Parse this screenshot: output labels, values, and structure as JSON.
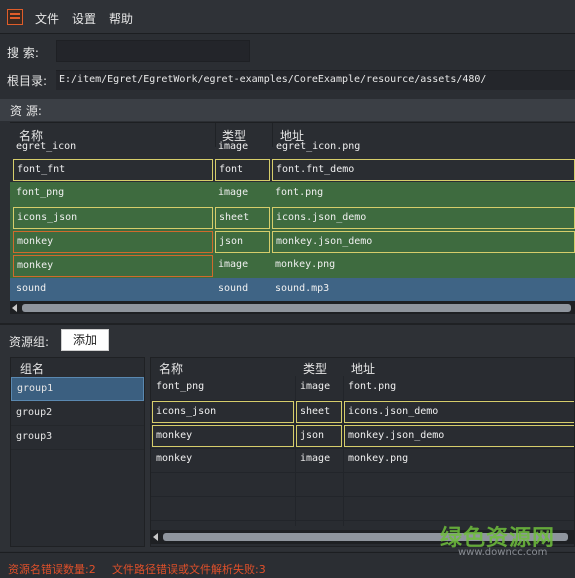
{
  "menu": {
    "file": "文件",
    "settings": "设置",
    "help": "帮助"
  },
  "search": {
    "label": "搜 索:",
    "value": ""
  },
  "root": {
    "label": "根目录:",
    "path": "E:/item/Egret/EgretWork/egret-examples/CoreExample/resource/assets/480/"
  },
  "resources": {
    "title": "资 源:",
    "headers": {
      "name": "名称",
      "type": "类型",
      "url": "地址"
    },
    "rows": [
      {
        "name": "egret_icon",
        "type": "image",
        "url": "egret_icon.png"
      },
      {
        "name": "font_fnt",
        "type": "font",
        "url": "font.fnt_demo"
      },
      {
        "name": "font_png",
        "type": "image",
        "url": "font.png"
      },
      {
        "name": "icons_json",
        "type": "sheet",
        "url": "icons.json_demo"
      },
      {
        "name": "monkey",
        "type": "json",
        "url": "monkey.json_demo"
      },
      {
        "name": "monkey",
        "type": "image",
        "url": "monkey.png"
      },
      {
        "name": "sound",
        "type": "sound",
        "url": "sound.mp3"
      }
    ]
  },
  "groups": {
    "label": "资源组:",
    "add_button": "添加",
    "header": "组名",
    "items": [
      "group1",
      "group2",
      "group3"
    ],
    "selected": "group1"
  },
  "group_resources": {
    "headers": {
      "name": "名称",
      "type": "类型",
      "url": "地址"
    },
    "rows": [
      {
        "name": "font_png",
        "type": "image",
        "url": "font.png"
      },
      {
        "name": "icons_json",
        "type": "sheet",
        "url": "icons.json_demo"
      },
      {
        "name": "monkey",
        "type": "json",
        "url": "monkey.json_demo"
      },
      {
        "name": "monkey",
        "type": "image",
        "url": "monkey.png"
      }
    ]
  },
  "status": {
    "name_errors": "资源名错误数量:2",
    "file_errors": "文件路径错误或文件解析失败:3"
  },
  "watermark": {
    "logo": "绿色资源网",
    "url": "www.downcc.com"
  },
  "colors": {
    "row_green": "#3e6b3f",
    "row_blue": "#3f6485",
    "border_yellow": "#d6cd6b",
    "border_orange": "#d06a2c",
    "error_text": "#e0502a"
  }
}
